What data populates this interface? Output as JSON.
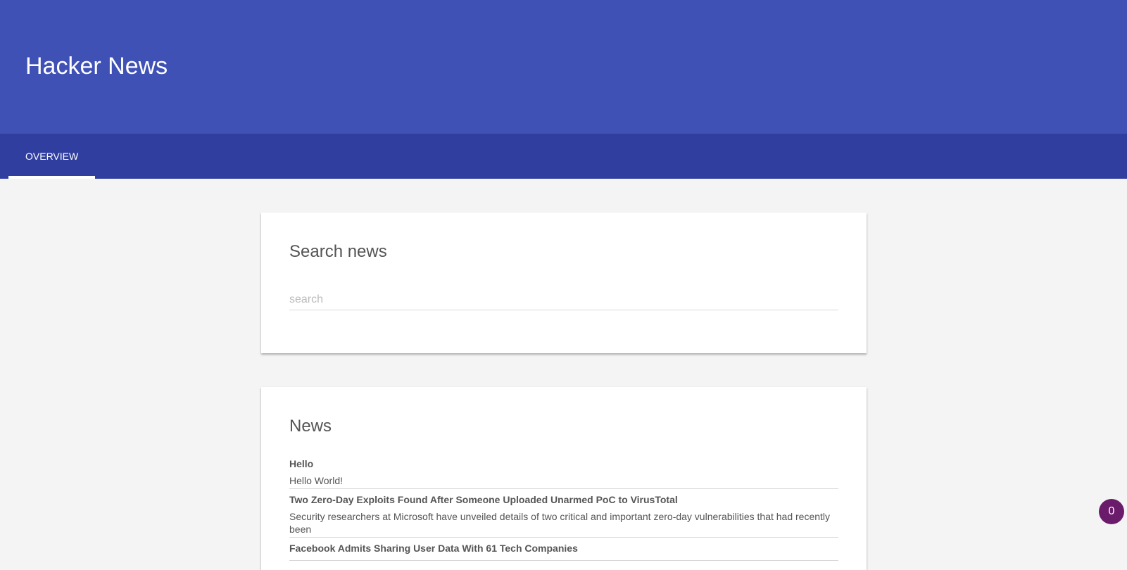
{
  "app": {
    "title": "Hacker News"
  },
  "tabs": [
    {
      "label": "OVERVIEW",
      "active": true
    }
  ],
  "search": {
    "title": "Search news",
    "placeholder": "search",
    "value": ""
  },
  "news": {
    "title": "News",
    "items": [
      {
        "title": "Hello",
        "body": "Hello World!"
      },
      {
        "title": "Two Zero-Day Exploits Found After Someone Uploaded Unarmed PoC to VirusTotal",
        "body": "Security researchers at Microsoft have unveiled details of two critical and important zero-day vulnerabilities that had recently been"
      },
      {
        "title": "Facebook Admits Sharing User Data With 61 Tech Companies",
        "body": ""
      }
    ]
  },
  "badge": {
    "count": "0"
  },
  "colors": {
    "header": "#3f51b5",
    "tabbar": "#303f9f",
    "badge": "#6a1b6a",
    "background": "#f4f4f4"
  }
}
